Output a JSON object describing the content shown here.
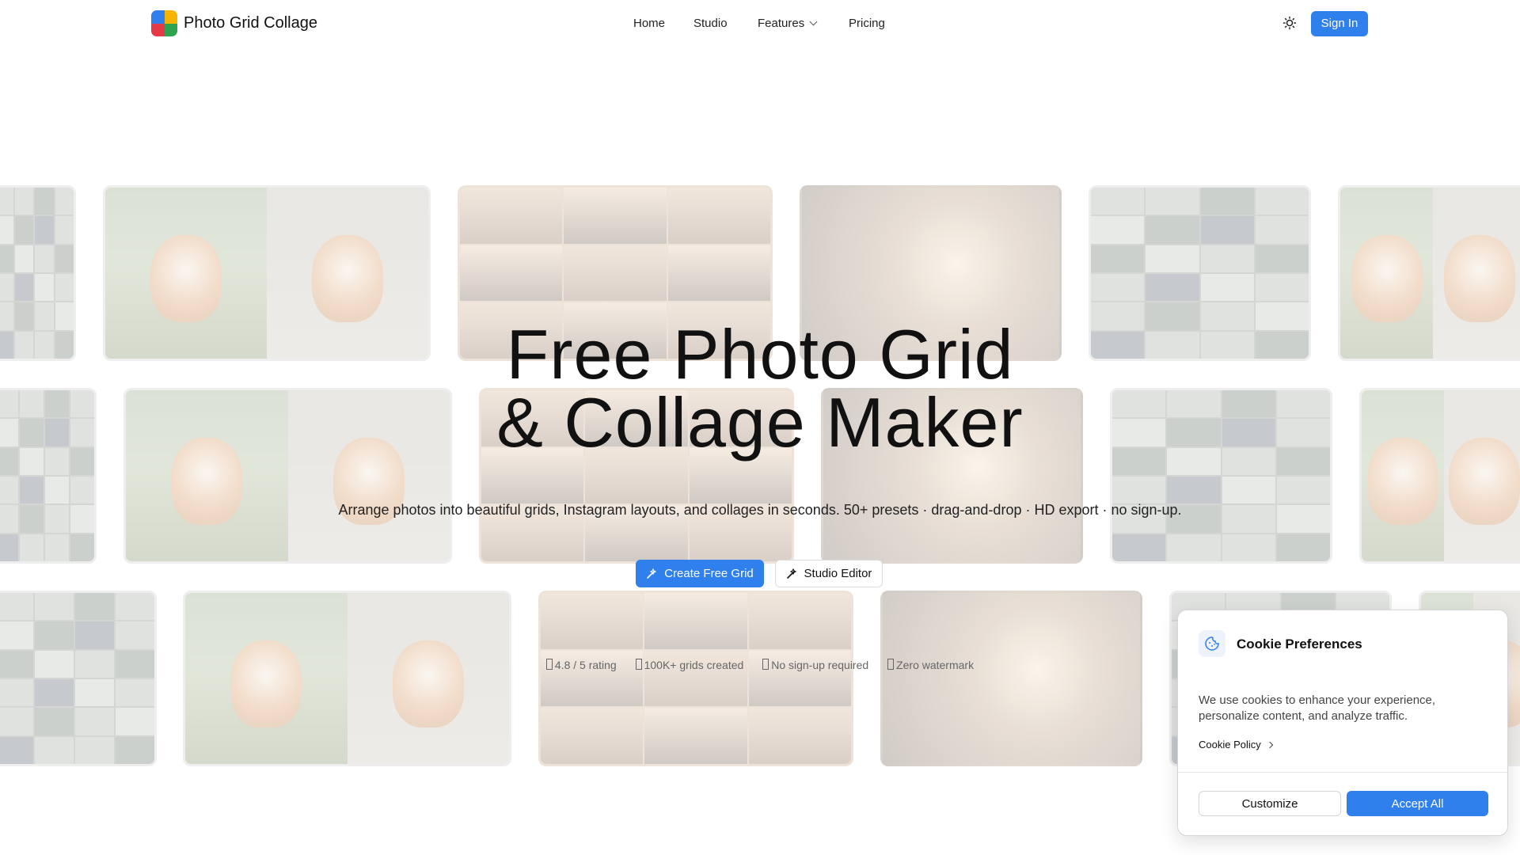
{
  "nav": {
    "brand": "Photo Grid Collage",
    "items": [
      {
        "label": "Home"
      },
      {
        "label": "Studio"
      },
      {
        "label": "Features"
      },
      {
        "label": "Pricing"
      }
    ],
    "signin_label": "Sign In",
    "theme_icon": "sun-icon"
  },
  "hero": {
    "title_line1": "Free Photo Grid",
    "title_line2": "& Collage Maker",
    "subtitle": "Arrange photos into beautiful grids, Instagram layouts, and collages in seconds. 50+ presets · drag-and-drop · HD export · no sign-up.",
    "primary_cta": "Create Free Grid",
    "secondary_cta": "Studio Editor",
    "stats": [
      "4.8 / 5 rating",
      "100K+ grids created",
      "No sign-up required",
      "Zero watermark"
    ]
  },
  "cookie": {
    "title": "Cookie Preferences",
    "text": "We use cookies to enhance your experience, personalize content, and analyze traffic.",
    "policy_link": "Cookie Policy",
    "customize_label": "Customize",
    "accept_label": "Accept All"
  },
  "colors": {
    "accent": "#2f80ed",
    "logo": [
      "#2f80ed",
      "#f5b400",
      "#e53945",
      "#2ea44f"
    ]
  }
}
